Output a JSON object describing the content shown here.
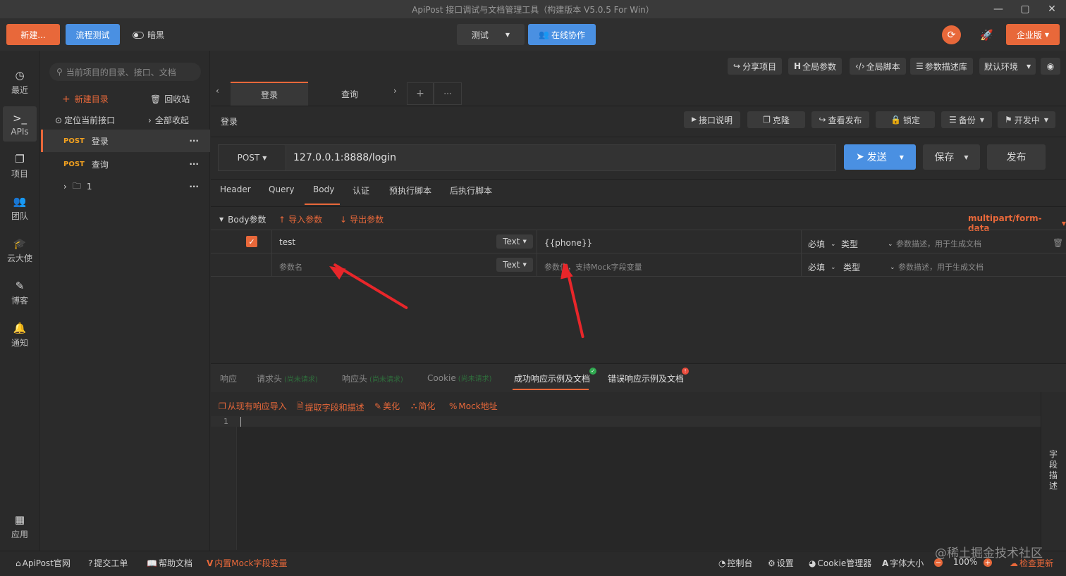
{
  "window": {
    "title": "ApiPost 接口调试与文档管理工具（构建版本 V5.0.5 For Win）"
  },
  "toolbar": {
    "new_label": "新建...",
    "flow_test_label": "流程测试",
    "dark_label": "暗黑",
    "env_label": "测试",
    "collab_label": "在线协作",
    "enterprise_label": "企业版"
  },
  "nav": {
    "recent": "最近",
    "apis": "APIs",
    "project": "项目",
    "team": "团队",
    "cloud": "云大使",
    "blog": "博客",
    "notify": "通知",
    "apps": "应用"
  },
  "tree": {
    "search_placeholder": "当前项目的目录、接口、文档",
    "new_dir": "新建目录",
    "recycle": "回收站",
    "locate": "定位当前接口",
    "collapse_all": "全部收起",
    "items": [
      {
        "method": "POST",
        "name": "登录"
      },
      {
        "method": "POST",
        "name": "查询"
      },
      {
        "folder": "1"
      }
    ]
  },
  "topright": {
    "share": "分享项目",
    "global_params": "全局参数",
    "global_script": "全局脚本",
    "param_lib": "参数描述库",
    "env": "默认环境"
  },
  "tabs": {
    "login": "登录",
    "query": "查询",
    "add": "+",
    "more": "···"
  },
  "api": {
    "name": "登录",
    "doc": "接口说明",
    "clone": "克隆",
    "view_publish": "查看发布",
    "lock": "锁定",
    "backup": "备份",
    "status": "开发中",
    "method": "POST",
    "url": "127.0.0.1:8888/login",
    "send": "发送",
    "save": "保存",
    "publish": "发布"
  },
  "req_tabs": [
    "Header",
    "Query",
    "Body",
    "认证",
    "预执行脚本",
    "后执行脚本"
  ],
  "body": {
    "label": "Body参数",
    "import": "导入参数",
    "export": "导出参数",
    "content_type": "multipart/form-data",
    "rows": [
      {
        "key": "test",
        "type": "Text",
        "value": "{{phone}}",
        "required": "必填",
        "kind": "类型",
        "desc_placeholder": "参数描述，用于生成文档"
      }
    ],
    "new_row": {
      "key_placeholder": "参数名",
      "type": "Text",
      "value_placeholder": "参数值，支持Mock字段变量",
      "required": "必填",
      "kind": "类型",
      "desc_placeholder": "参数描述，用于生成文档"
    }
  },
  "resp_tabs": {
    "resp": "响应",
    "req_headers": "请求头",
    "req_headers_note": "(尚未请求)",
    "resp_headers": "响应头",
    "resp_headers_note": "(尚未请求)",
    "cookie": "Cookie",
    "cookie_note": "(尚未请求)",
    "success_doc": "成功响应示例及文档",
    "error_doc": "错误响应示例及文档"
  },
  "resp_tools": {
    "import_existing": "从现有响应导入",
    "extract": "提取字段和描述",
    "beautify": "美化",
    "simplify": "简化",
    "mock_addr": "Mock地址"
  },
  "editor": {
    "line1": "1"
  },
  "side_panel": "字段描述",
  "statusbar": {
    "site": "ApiPost官网",
    "ticket": "提交工单",
    "help": "帮助文档",
    "mock": "内置Mock字段变量",
    "console": "控制台",
    "settings": "设置",
    "cookie": "Cookie管理器",
    "font": "字体大小",
    "zoom": "100%",
    "update": "检查更新"
  },
  "watermark": "@稀土掘金技术社区",
  "colors": {
    "accent": "#e8683a",
    "blue": "#4a90e2",
    "post": "#f0a020"
  }
}
